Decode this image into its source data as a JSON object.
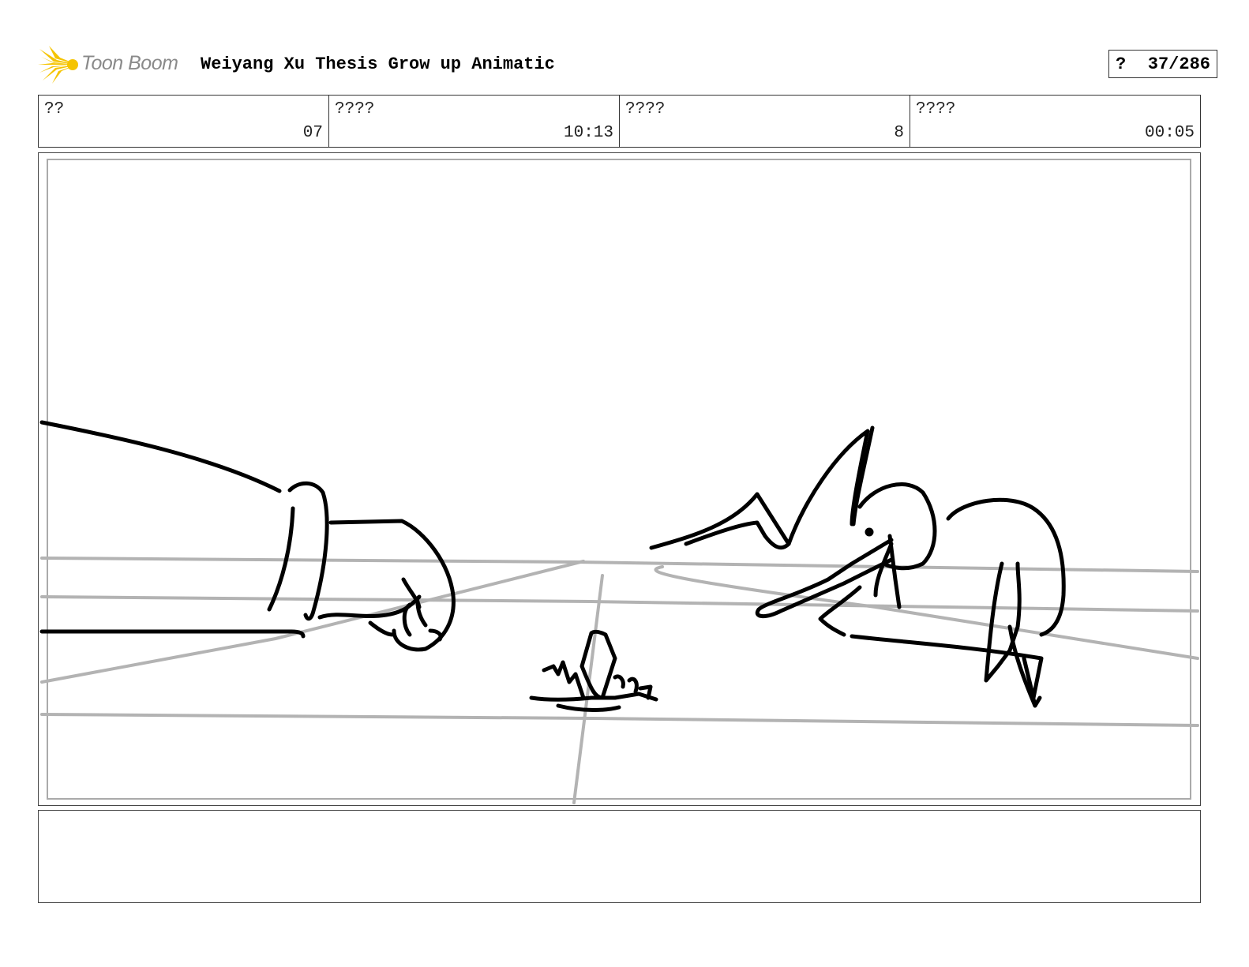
{
  "header": {
    "logo_text": "Toon Boom",
    "title": "Weiyang Xu Thesis Grow up Animatic",
    "page_marker": "?",
    "page_number": "37/286"
  },
  "info": [
    {
      "label": "??",
      "value": "07"
    },
    {
      "label": "????",
      "value": "10:13"
    },
    {
      "label": "????",
      "value": "8"
    },
    {
      "label": "????",
      "value": "00:05"
    }
  ],
  "panel": {
    "description_visible": false
  },
  "notes": {
    "text": ""
  },
  "colors": {
    "logo_yellow": "#f5c400",
    "logo_text": "#8a8a8a",
    "guide_lines": "#b3b3b3",
    "ink": "#000000"
  }
}
